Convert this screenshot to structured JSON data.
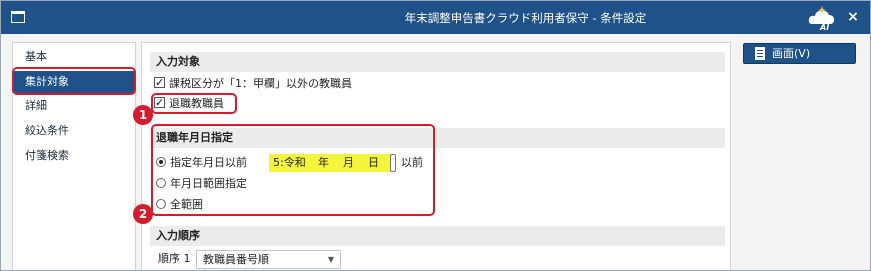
{
  "window": {
    "title": "年末調整申告書クラウド利用者保守 - 条件設定",
    "ai_badge": "AI",
    "close_glyph": "×"
  },
  "sidebar": {
    "items": [
      {
        "label": "基本",
        "active": false
      },
      {
        "label": "集計対象",
        "active": true
      },
      {
        "label": "詳細",
        "active": false
      },
      {
        "label": "絞込条件",
        "active": false
      },
      {
        "label": "付箋検索",
        "active": false
      }
    ]
  },
  "input_target": {
    "heading": "入力対象",
    "options": [
      {
        "label": "課税区分が「1：甲欄」以外の教職員",
        "checked": true
      },
      {
        "label": "退職教職員",
        "checked": true
      }
    ]
  },
  "retirement_date": {
    "heading": "退職年月日指定",
    "options": [
      {
        "label": "指定年月日以前",
        "checked": true
      },
      {
        "label": "年月日範囲指定",
        "checked": false
      },
      {
        "label": "全範囲",
        "checked": false
      }
    ],
    "date": {
      "era": "5:令和",
      "year_unit": "年",
      "month_unit": "月",
      "day_unit": "日",
      "suffix": "以前"
    }
  },
  "input_order": {
    "heading": "入力順序",
    "order_label": "順序 1",
    "selected": "教職員番号順"
  },
  "actions": {
    "screen_button": "画面(V)"
  },
  "annotations": {
    "badge1": "1",
    "badge2": "2"
  },
  "colors": {
    "titlebar": "#1e5288",
    "accent": "#1e5288",
    "annotation_red": "#d81b2c",
    "date_highlight": "#f4f43a"
  }
}
